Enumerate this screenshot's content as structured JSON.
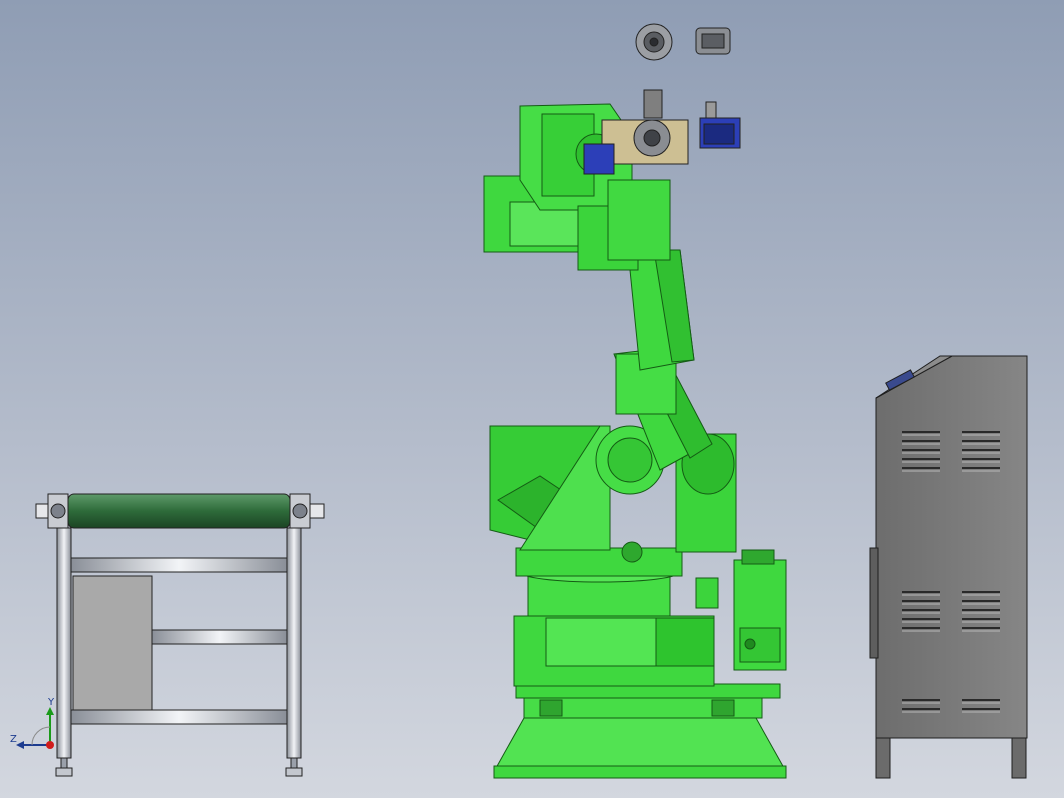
{
  "viewport": {
    "background_top": "#8f9db4",
    "background_bottom": "#d3d7df"
  },
  "scene": {
    "robot_color": "#3fd83f",
    "robot_dark": "#1f8a1f",
    "controller_color": "#7a7a7a",
    "conveyor_roller_color": "#2e6b3a",
    "gripper_color": "#2c3fb8",
    "objects": [
      "conveyor-stand",
      "industrial-robot",
      "robot-controller-cabinet",
      "gripper-tool-parts"
    ]
  },
  "triad": {
    "y_label": "Y",
    "z_label": "Z"
  }
}
